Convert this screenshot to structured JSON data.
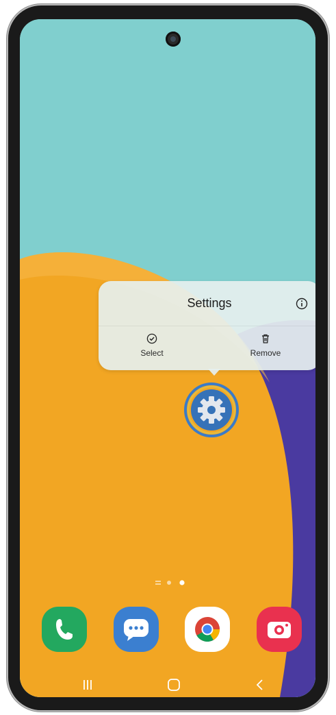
{
  "context_menu": {
    "title": "Settings",
    "info_icon": "info-icon",
    "actions": [
      {
        "label": "Select",
        "icon": "check-circle-icon"
      },
      {
        "label": "Remove",
        "icon": "trash-icon"
      }
    ]
  },
  "app_icon": {
    "name": "settings-app-icon",
    "icon": "gear-icon",
    "color": "#3672b8"
  },
  "home_pages": {
    "indicators": [
      "apps-page-indicator",
      "page-dot",
      "page-dot-current"
    ]
  },
  "dock": [
    {
      "icon": "phone-icon",
      "color": "#23a85f"
    },
    {
      "icon": "messages-icon",
      "color": "#3b7fd0"
    },
    {
      "icon": "chrome-icon",
      "color": "#ffffff"
    },
    {
      "icon": "camera-icon",
      "color": "#e9314f"
    }
  ],
  "navigation_bar": {
    "buttons": [
      "recent-apps-icon",
      "home-icon",
      "back-icon"
    ]
  },
  "colors": {
    "wallpaper_sky": "#80cfce",
    "wallpaper_orange": "#f2a623",
    "wallpaper_purple": "#4a3aa0",
    "highlight_ring": "#e6b93c"
  }
}
